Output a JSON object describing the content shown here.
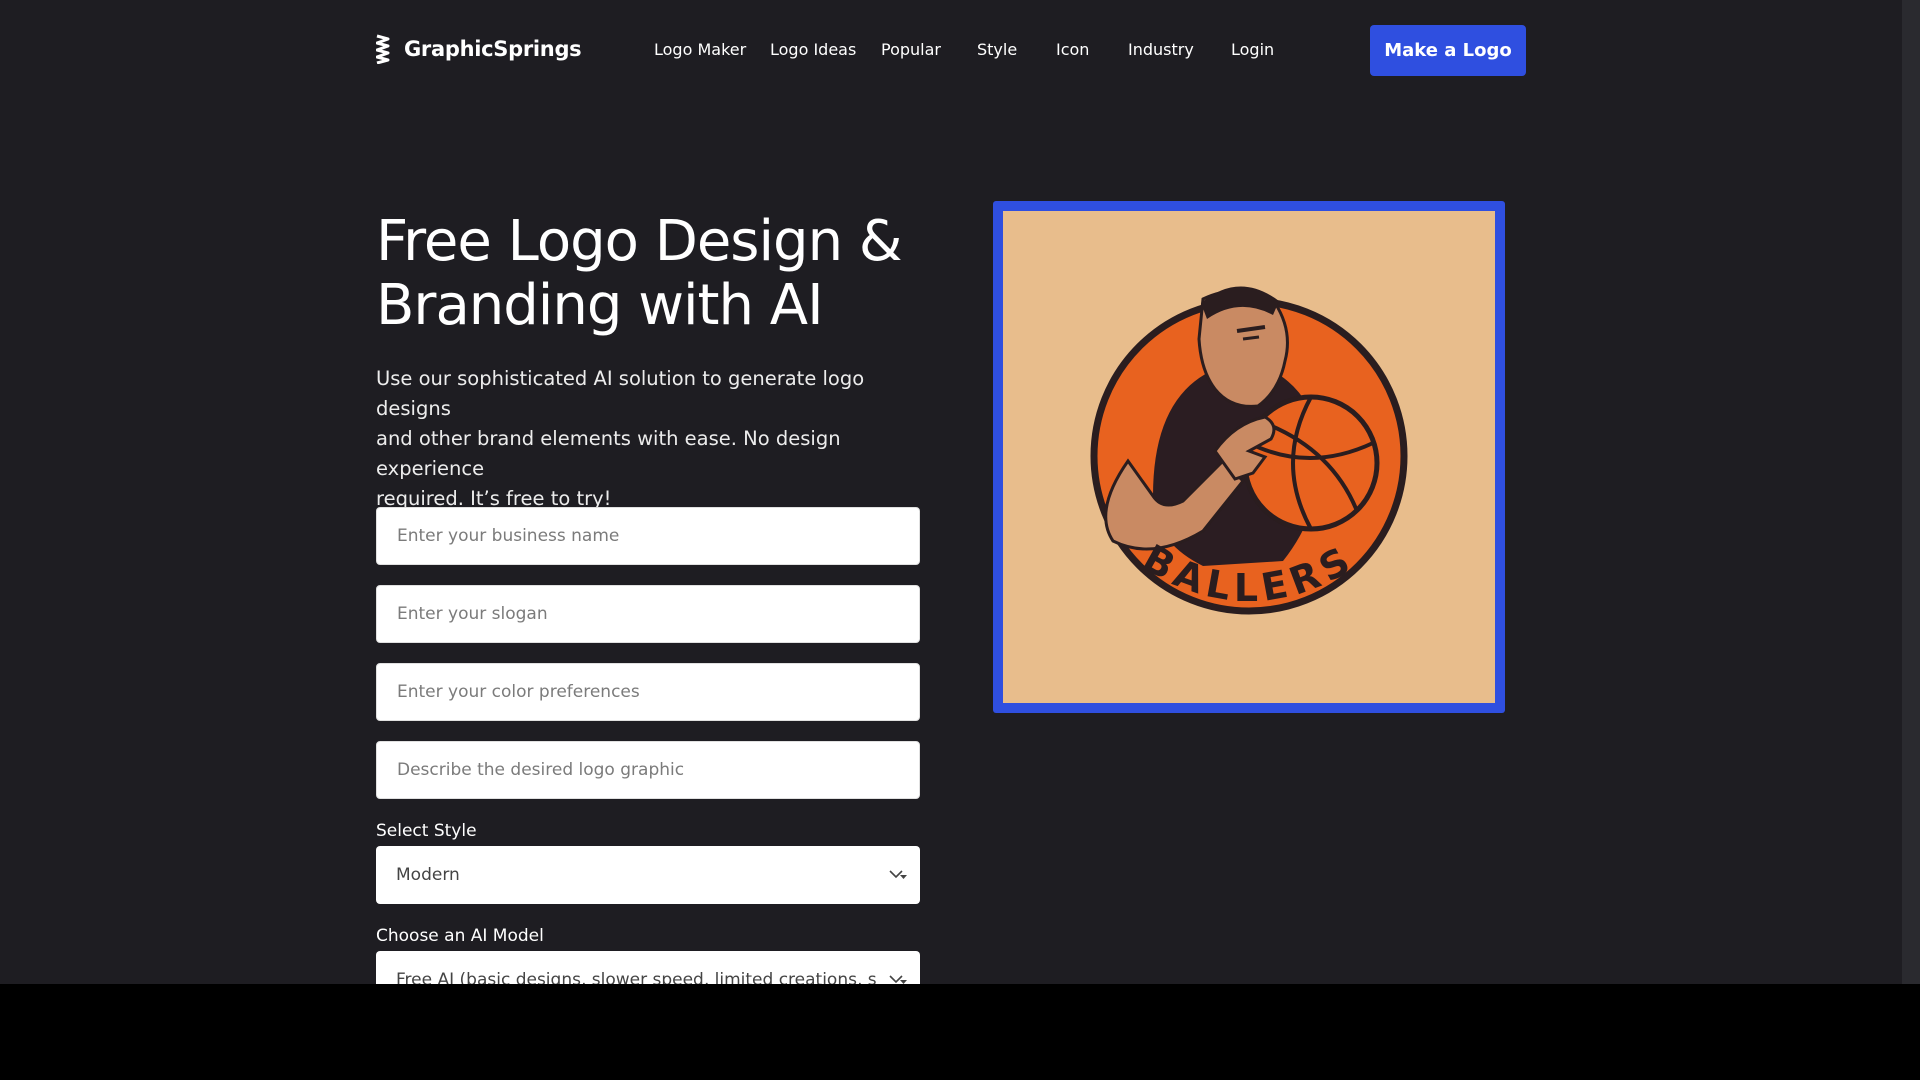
{
  "header": {
    "brand": "GraphicSprings",
    "brand_icon": "graphicsprings-spring-icon",
    "nav": [
      "Logo Maker",
      "Logo Ideas",
      "Popular",
      "Style",
      "Icon",
      "Industry",
      "Login"
    ],
    "cta_label": "Make a Logo"
  },
  "hero": {
    "title_line1": "Free Logo Design &",
    "title_line2": "Branding with AI",
    "subtitle_line1": "Use our sophisticated AI solution to generate logo designs",
    "subtitle_line2": "and other brand elements with ease. No design experience",
    "subtitle_line3": "required. It’s free to try!"
  },
  "form": {
    "business_name_placeholder": "Enter your business name",
    "slogan_placeholder": "Enter your slogan",
    "color_placeholder": "Enter your color preferences",
    "graphic_placeholder": "Describe the desired logo graphic",
    "style_label": "Select Style",
    "style_value": "Modern",
    "model_label": "Choose an AI Model",
    "model_value": "Free AI (basic designs, slower speed, limited creations, spelling errors)"
  },
  "preview": {
    "logo_text": "BALLERS"
  },
  "colors": {
    "background": "#1e1d22",
    "accent": "#2f4fe0",
    "preview_bg": "#e8bd8c",
    "ball_orange": "#e8621f"
  }
}
